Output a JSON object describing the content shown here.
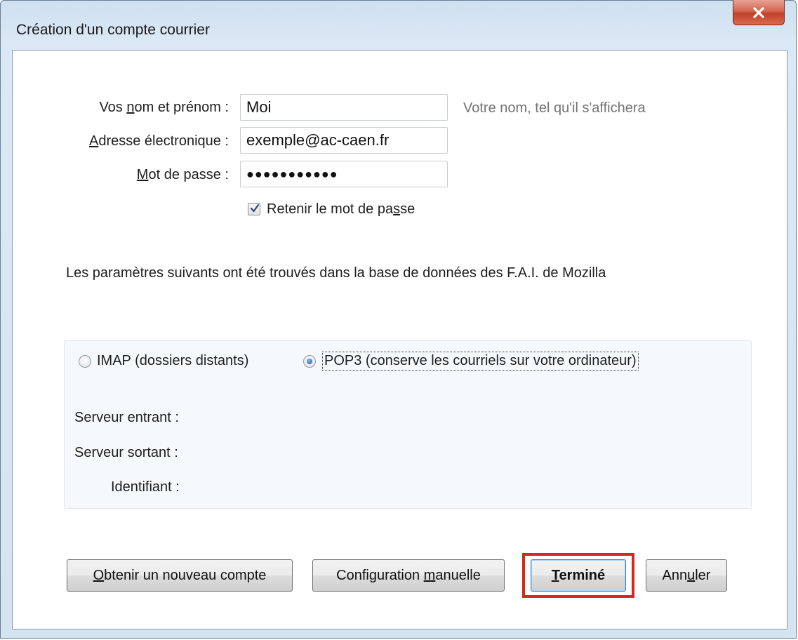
{
  "window": {
    "title": "Création d'un compte courrier"
  },
  "form": {
    "name_label_pre": "Vos ",
    "name_label_ul": "n",
    "name_label_post": "om et prénom :",
    "name_value": "Moi",
    "name_hint": "Votre nom, tel qu'il s'affichera",
    "email_label_ul": "A",
    "email_label_post": "dresse électronique :",
    "email_value": "exemple@ac-caen.fr",
    "password_label_ul": "M",
    "password_label_post": "ot de passe :",
    "password_value": "●●●●●●●●●●●",
    "remember_label_pre": "Retenir le mot de pa",
    "remember_label_ul": "s",
    "remember_label_post": "se",
    "remember_checked": true
  },
  "info": {
    "text": "Les paramètres suivants ont été trouvés dans la base de données des F.A.I. de Mozilla"
  },
  "protocol": {
    "imap_label": "IMAP (dossiers distants)",
    "pop3_label": "POP3 (conserve les courriels sur votre ordinateur)",
    "selected": "POP3"
  },
  "servers": {
    "incoming_label": "Serveur entrant :",
    "outgoing_label": "Serveur sortant :",
    "identifier_label": "Identifiant :"
  },
  "buttons": {
    "new_account_ul": "O",
    "new_account_post": "btenir un nouveau compte",
    "manual_pre": "Configuration ",
    "manual_ul": "m",
    "manual_post": "anuelle",
    "done_ul": "T",
    "done_post": "erminé",
    "cancel_pre": "Ann",
    "cancel_ul": "u",
    "cancel_post": "ler"
  },
  "colors": {
    "highlight": "#d42a1a",
    "close_button": "#c2412a"
  }
}
